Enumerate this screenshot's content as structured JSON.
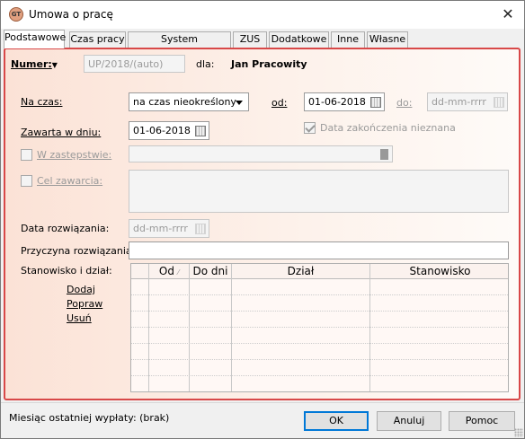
{
  "window": {
    "title": "Umowa o pracę",
    "icon": "app-logo-icon",
    "close": "✕"
  },
  "tabs": [
    "Podstawowe",
    "Czas pracy",
    "System wynagrodzeń",
    "ZUS",
    "Dodatkowe",
    "Inne",
    "Własne"
  ],
  "active_tab": "Podstawowe",
  "form": {
    "numer_label": "Numer:",
    "numer_value": "UP/2018/(auto)",
    "dla_label": "dla:",
    "employee_name": "Jan Pracowity",
    "na_czas_label": "Na czas:",
    "na_czas_value": "na czas nieokreślony",
    "od_label": "od:",
    "od_value": "01-06-2018",
    "do_label": "do:",
    "do_placeholder": "dd-mm-rrrr",
    "zawarta_label": "Zawarta w dniu:",
    "zawarta_value": "01-06-2018",
    "data_zak_nieznana_label": "Data zakończenia nieznana",
    "data_zak_nieznana_checked": true,
    "w_zastepstwie_label": "W zastępstwie:",
    "cel_zawarcia_label": "Cel zawarcia:",
    "data_rozwiazania_label": "Data rozwiązania:",
    "data_rozwiazania_placeholder": "dd-mm-rrrr",
    "przyczyna_label": "Przyczyna rozwiązania:",
    "stanowiska_label": "Stanowisko i dział:"
  },
  "grid": {
    "headers": [
      "Od",
      "Do dni",
      "Dział",
      "Stanowisko"
    ],
    "rows": 7
  },
  "links": {
    "dodaj": "Dodaj",
    "popraw": "Popraw",
    "usun": "Usuń"
  },
  "footer": {
    "status": "Miesiąc ostatniej wypłaty: (brak)",
    "ok": "OK",
    "cancel": "Anuluj",
    "help": "Pomoc"
  }
}
